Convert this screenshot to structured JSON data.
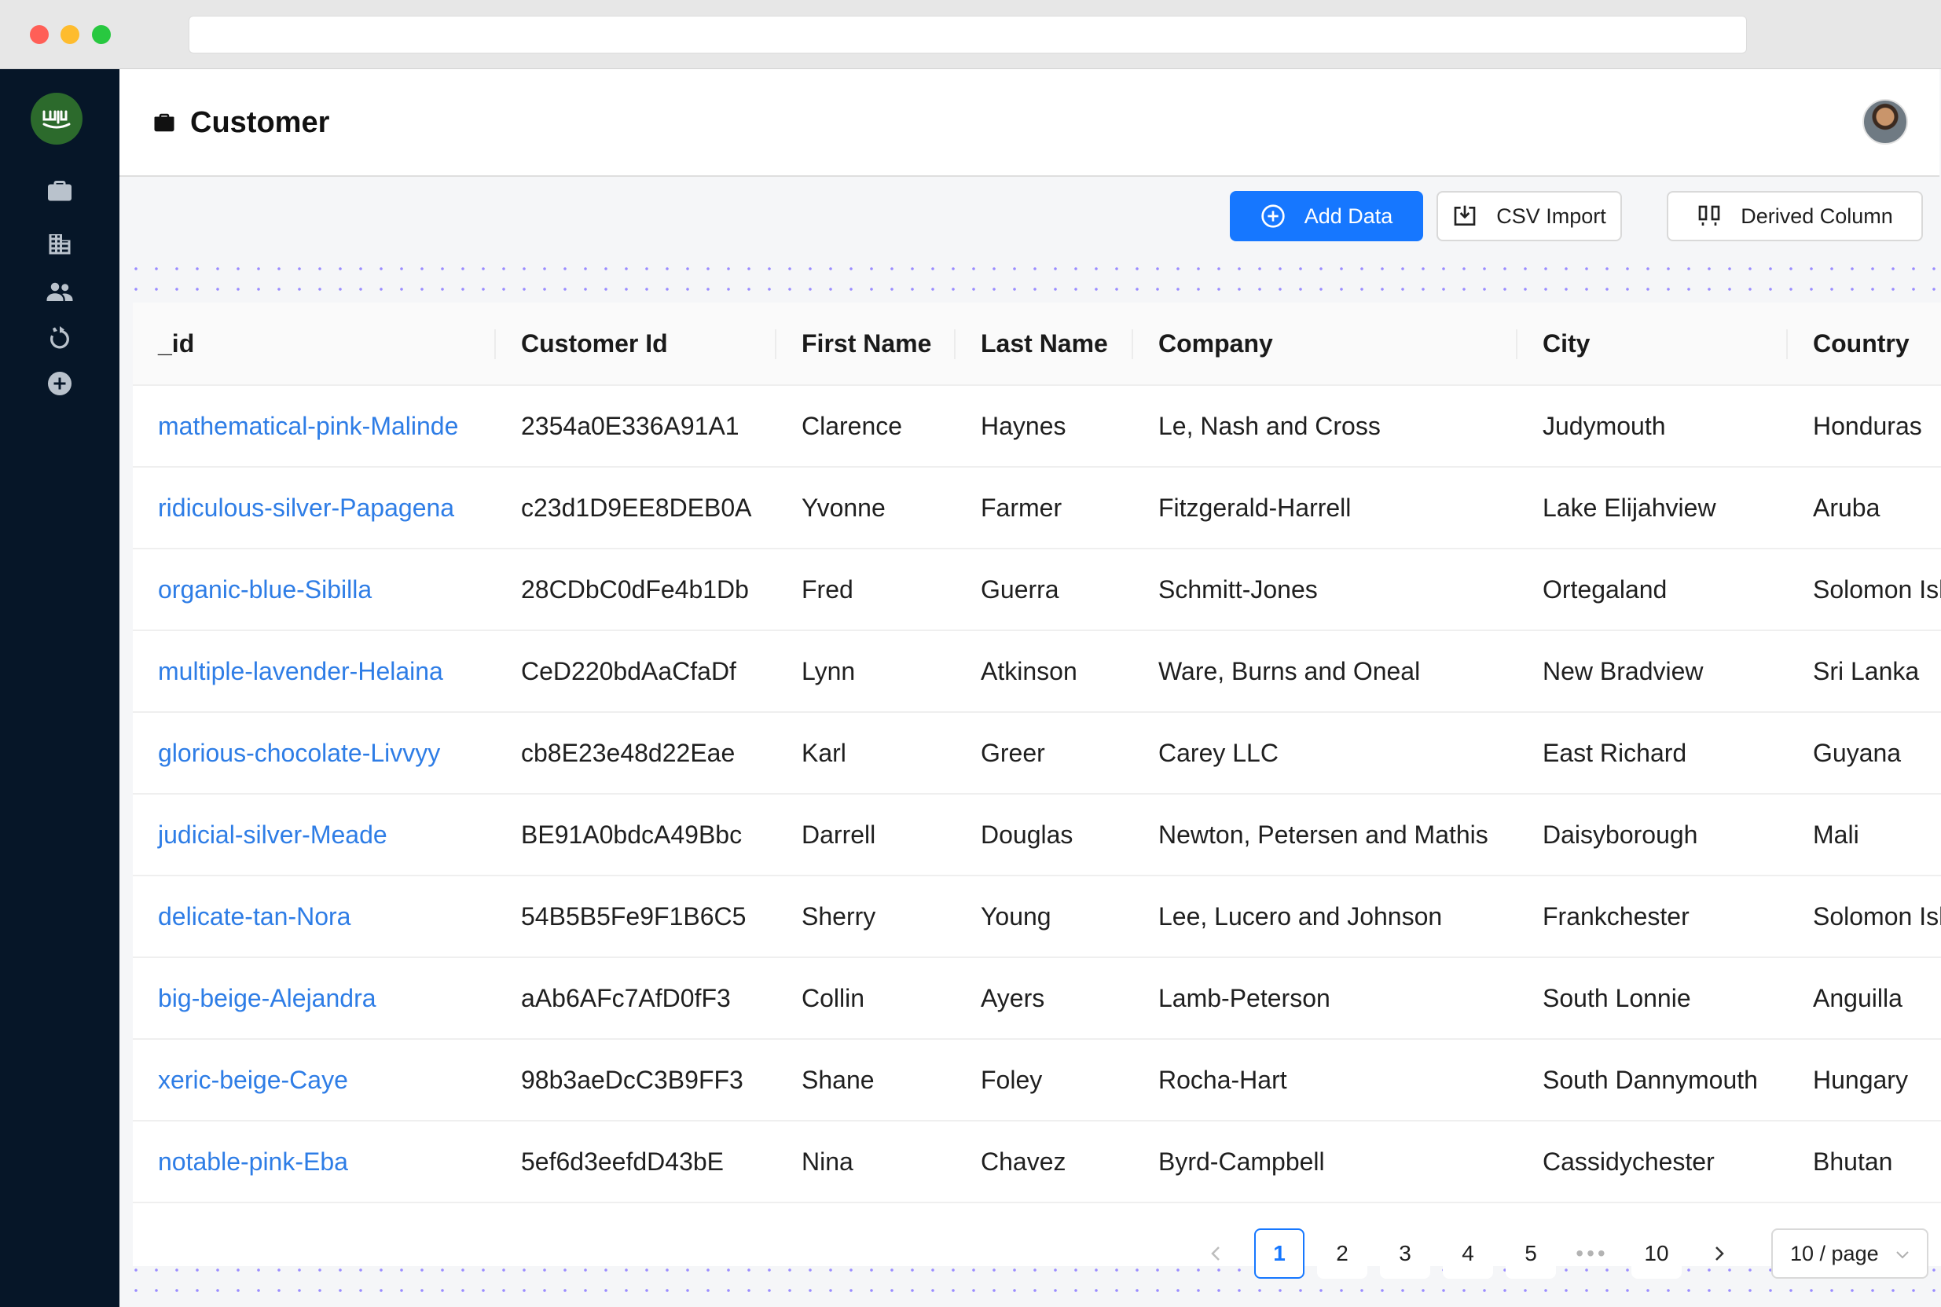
{
  "header": {
    "title": "Customer"
  },
  "toolbar": {
    "add_label": "Add Data",
    "csv_label": "CSV Import",
    "derived_label": "Derived Column"
  },
  "sidebar": {
    "logo_text": "ꭍ𐐁",
    "icons": [
      "briefcase-icon",
      "building-icon",
      "users-icon",
      "cycle-icon",
      "plus-circle-icon"
    ]
  },
  "table": {
    "columns": [
      "_id",
      "Customer Id",
      "First Name",
      "Last Name",
      "Company",
      "City",
      "Country"
    ],
    "rows": [
      [
        "mathematical-pink-Malinde",
        "2354a0E336A91A1",
        "Clarence",
        "Haynes",
        "Le, Nash and Cross",
        "Judymouth",
        "Honduras"
      ],
      [
        "ridiculous-silver-Papagena",
        "c23d1D9EE8DEB0A",
        "Yvonne",
        "Farmer",
        "Fitzgerald-Harrell",
        "Lake Elijahview",
        "Aruba"
      ],
      [
        "organic-blue-Sibilla",
        "28CDbC0dFe4b1Db",
        "Fred",
        "Guerra",
        "Schmitt-Jones",
        "Ortegaland",
        "Solomon Islands"
      ],
      [
        "multiple-lavender-Helaina",
        "CeD220bdAaCfaDf",
        "Lynn",
        "Atkinson",
        "Ware, Burns and Oneal",
        "New Bradview",
        "Sri Lanka"
      ],
      [
        "glorious-chocolate-Livvyy",
        "cb8E23e48d22Eae",
        "Karl",
        "Greer",
        "Carey LLC",
        "East Richard",
        "Guyana"
      ],
      [
        "judicial-silver-Meade",
        "BE91A0bdcA49Bbc",
        "Darrell",
        "Douglas",
        "Newton, Petersen and Mathis",
        "Daisyborough",
        "Mali"
      ],
      [
        "delicate-tan-Nora",
        "54B5B5Fe9F1B6C5",
        "Sherry",
        "Young",
        "Lee, Lucero and Johnson",
        "Frankchester",
        "Solomon Islands"
      ],
      [
        "big-beige-Alejandra",
        "aAb6AFc7AfD0fF3",
        "Collin",
        "Ayers",
        "Lamb-Peterson",
        "South Lonnie",
        "Anguilla"
      ],
      [
        "xeric-beige-Caye",
        "98b3aeDcC3B9FF3",
        "Shane",
        "Foley",
        "Rocha-Hart",
        "South Dannymouth",
        "Hungary"
      ],
      [
        "notable-pink-Eba",
        "5ef6d3eefdD43bE",
        "Nina",
        "Chavez",
        "Byrd-Campbell",
        "Cassidychester",
        "Bhutan"
      ]
    ]
  },
  "pagination": {
    "pages": [
      "1",
      "2",
      "3",
      "4",
      "5",
      "10"
    ],
    "current": "1",
    "ellipsis": "•••",
    "page_size": "10 / page"
  },
  "colors": {
    "accent": "#1677ff",
    "link": "#2e7de6",
    "sidebar_bg": "#061628",
    "logo_bg": "#2c6a2c"
  }
}
